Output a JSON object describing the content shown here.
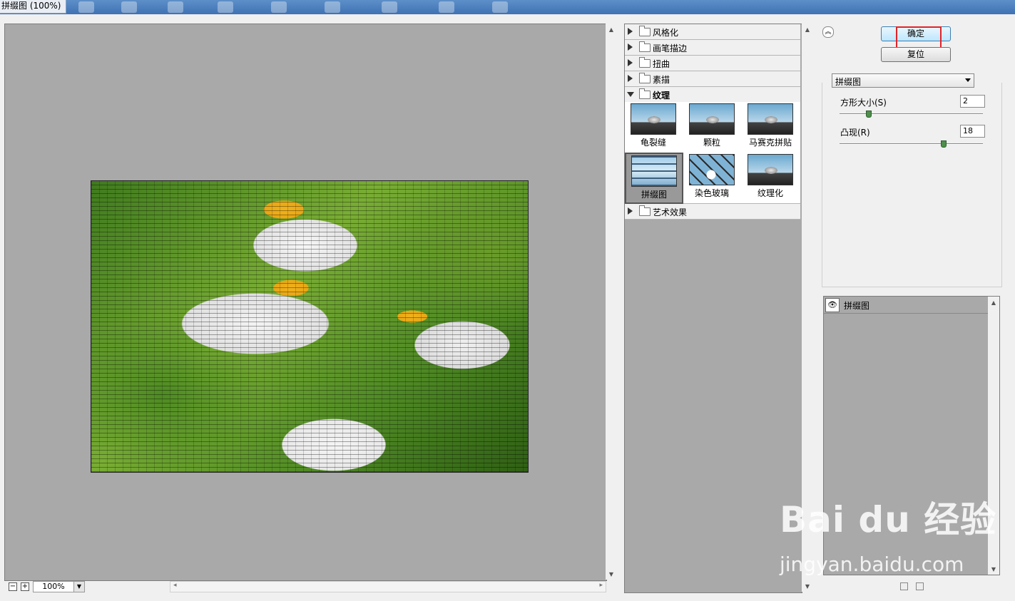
{
  "window": {
    "title": "拼缀图 (100%)"
  },
  "preview": {
    "zoom": "100%"
  },
  "gallery": {
    "categories": [
      {
        "label": "风格化"
      },
      {
        "label": "画笔描边"
      },
      {
        "label": "扭曲"
      },
      {
        "label": "素描"
      },
      {
        "label": "纹理"
      },
      {
        "label": "艺术效果"
      }
    ],
    "texture_filters": [
      {
        "label": "龟裂缝"
      },
      {
        "label": "颗粒"
      },
      {
        "label": "马赛克拼贴"
      },
      {
        "label": "拼缀图"
      },
      {
        "label": "染色玻璃"
      },
      {
        "label": "纹理化"
      }
    ],
    "selected_filter": "拼缀图"
  },
  "settings": {
    "ok_label": "确定",
    "reset_label": "复位",
    "filter_select": "拼缀图",
    "square_size_label": "方形大小(S)",
    "square_size_value": "2",
    "square_size_fraction": 0.2,
    "relief_label": "凸现(R)",
    "relief_value": "18",
    "relief_fraction": 0.72
  },
  "layers": {
    "items": [
      {
        "name": "拼缀图"
      }
    ]
  },
  "watermark": {
    "brand": "Bai du 经验",
    "url": "jingyan.baidu.com"
  },
  "colors": {
    "highlight": "#e0242a",
    "panel_gray": "#a9a9a9"
  }
}
